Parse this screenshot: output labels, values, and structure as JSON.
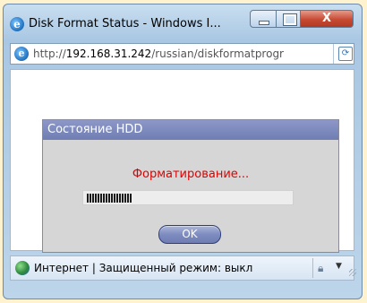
{
  "window": {
    "title": "Disk Format Status - Windows I...",
    "close_glyph": "X"
  },
  "address_bar": {
    "url_prefix": "http://",
    "url_host": "192.168.31.242",
    "url_path": "/russian/diskformatprogr"
  },
  "dialog": {
    "header": "Состояние HDD",
    "message": "Форматирование...",
    "progress_percent": 22,
    "ok_label": "OK"
  },
  "status_bar": {
    "text": "Интернет | Защищенный режим: выкл"
  },
  "icons": {
    "browser": "ie-logo-icon",
    "page": "ie-page-icon",
    "refresh": "compatibility-icon",
    "zone": "internet-globe-icon",
    "security": "zone-lock-icon",
    "dropdown": "chevron-down-icon"
  }
}
